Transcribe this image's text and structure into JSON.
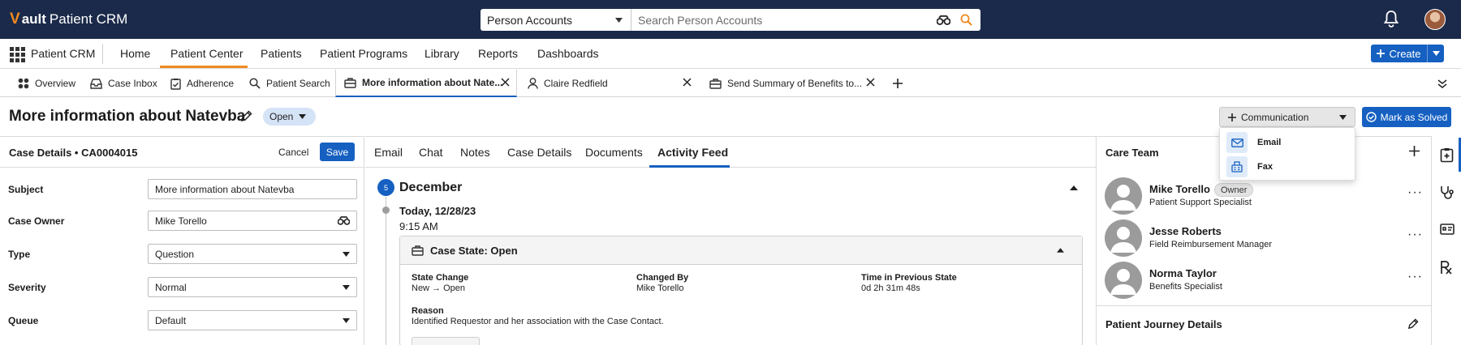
{
  "app": {
    "brand_prefix": "V",
    "brand": "ault",
    "product": "Patient CRM"
  },
  "search": {
    "scope": "Person Accounts",
    "placeholder": "Search Person Accounts"
  },
  "nav": {
    "app_name": "Patient CRM",
    "tabs": [
      {
        "label": "Home"
      },
      {
        "label": "Patient Center"
      },
      {
        "label": "Patients"
      },
      {
        "label": "Patient Programs"
      },
      {
        "label": "Library"
      },
      {
        "label": "Reports"
      },
      {
        "label": "Dashboards"
      }
    ],
    "active_tab": "Patient Center",
    "create_label": "Create"
  },
  "subtabs": [
    {
      "label": "Overview",
      "icon": "overview-icon"
    },
    {
      "label": "Case Inbox",
      "icon": "inbox-icon"
    },
    {
      "label": "Adherence",
      "icon": "checklist-icon"
    },
    {
      "label": "Patient Search",
      "icon": "search-icon"
    },
    {
      "label": "More information about Nate...",
      "icon": "briefcase-icon",
      "active": true
    },
    {
      "label": "Claire Redfield",
      "icon": "person-icon"
    },
    {
      "label": "Send Summary of Benefits to...",
      "icon": "briefcase-icon"
    }
  ],
  "record": {
    "title": "More information about Natevba",
    "status": "Open",
    "communication_label": "Communication",
    "solve_label": "Mark as Solved"
  },
  "communication_menu": [
    {
      "label": "Email",
      "icon": "mail-icon"
    },
    {
      "label": "Fax",
      "icon": "fax-icon"
    }
  ],
  "case_details": {
    "title": "Case Details • CA0004015",
    "cancel_label": "Cancel",
    "save_label": "Save",
    "fields": [
      {
        "label": "Subject",
        "value": "More information about Natevba",
        "control": "text"
      },
      {
        "label": "Case Owner",
        "value": "Mike Torello",
        "control": "lookup"
      },
      {
        "label": "Type",
        "value": "Question",
        "control": "select"
      },
      {
        "label": "Severity",
        "value": "Normal",
        "control": "select"
      },
      {
        "label": "Queue",
        "value": "Default",
        "control": "select"
      }
    ]
  },
  "activity": {
    "tabs": [
      {
        "label": "Email"
      },
      {
        "label": "Chat"
      },
      {
        "label": "Notes"
      },
      {
        "label": "Case Details"
      },
      {
        "label": "Documents"
      },
      {
        "label": "Activity Feed"
      }
    ],
    "active_tab": "Activity Feed",
    "month_count": "5",
    "month": "December",
    "day": "Today, 12/28/23",
    "time": "9:15 AM",
    "card": {
      "title": "Case State: Open",
      "state_change_label": "State Change",
      "state_change_value": "New → Open",
      "changed_by_label": "Changed By",
      "changed_by_value": "Mike Torello",
      "time_prev_label": "Time in Previous State",
      "time_prev_value": "0d 2h 31m 48s",
      "reason_label": "Reason",
      "reason_value": "Identified Requestor and her association with the Case Contact."
    }
  },
  "care_team": {
    "title": "Care Team",
    "members": [
      {
        "name": "Mike Torello",
        "role": "Patient Support Specialist",
        "tag": "Owner"
      },
      {
        "name": "Jesse Roberts",
        "role": "Field Reimbursement Manager"
      },
      {
        "name": "Norma Taylor",
        "role": "Benefits Specialist"
      }
    ],
    "journey_title": "Patient Journey Details"
  },
  "colors": {
    "topbar": "#1b2a4a",
    "accent_orange": "#f18a1f",
    "primary_blue": "#1560c1"
  }
}
